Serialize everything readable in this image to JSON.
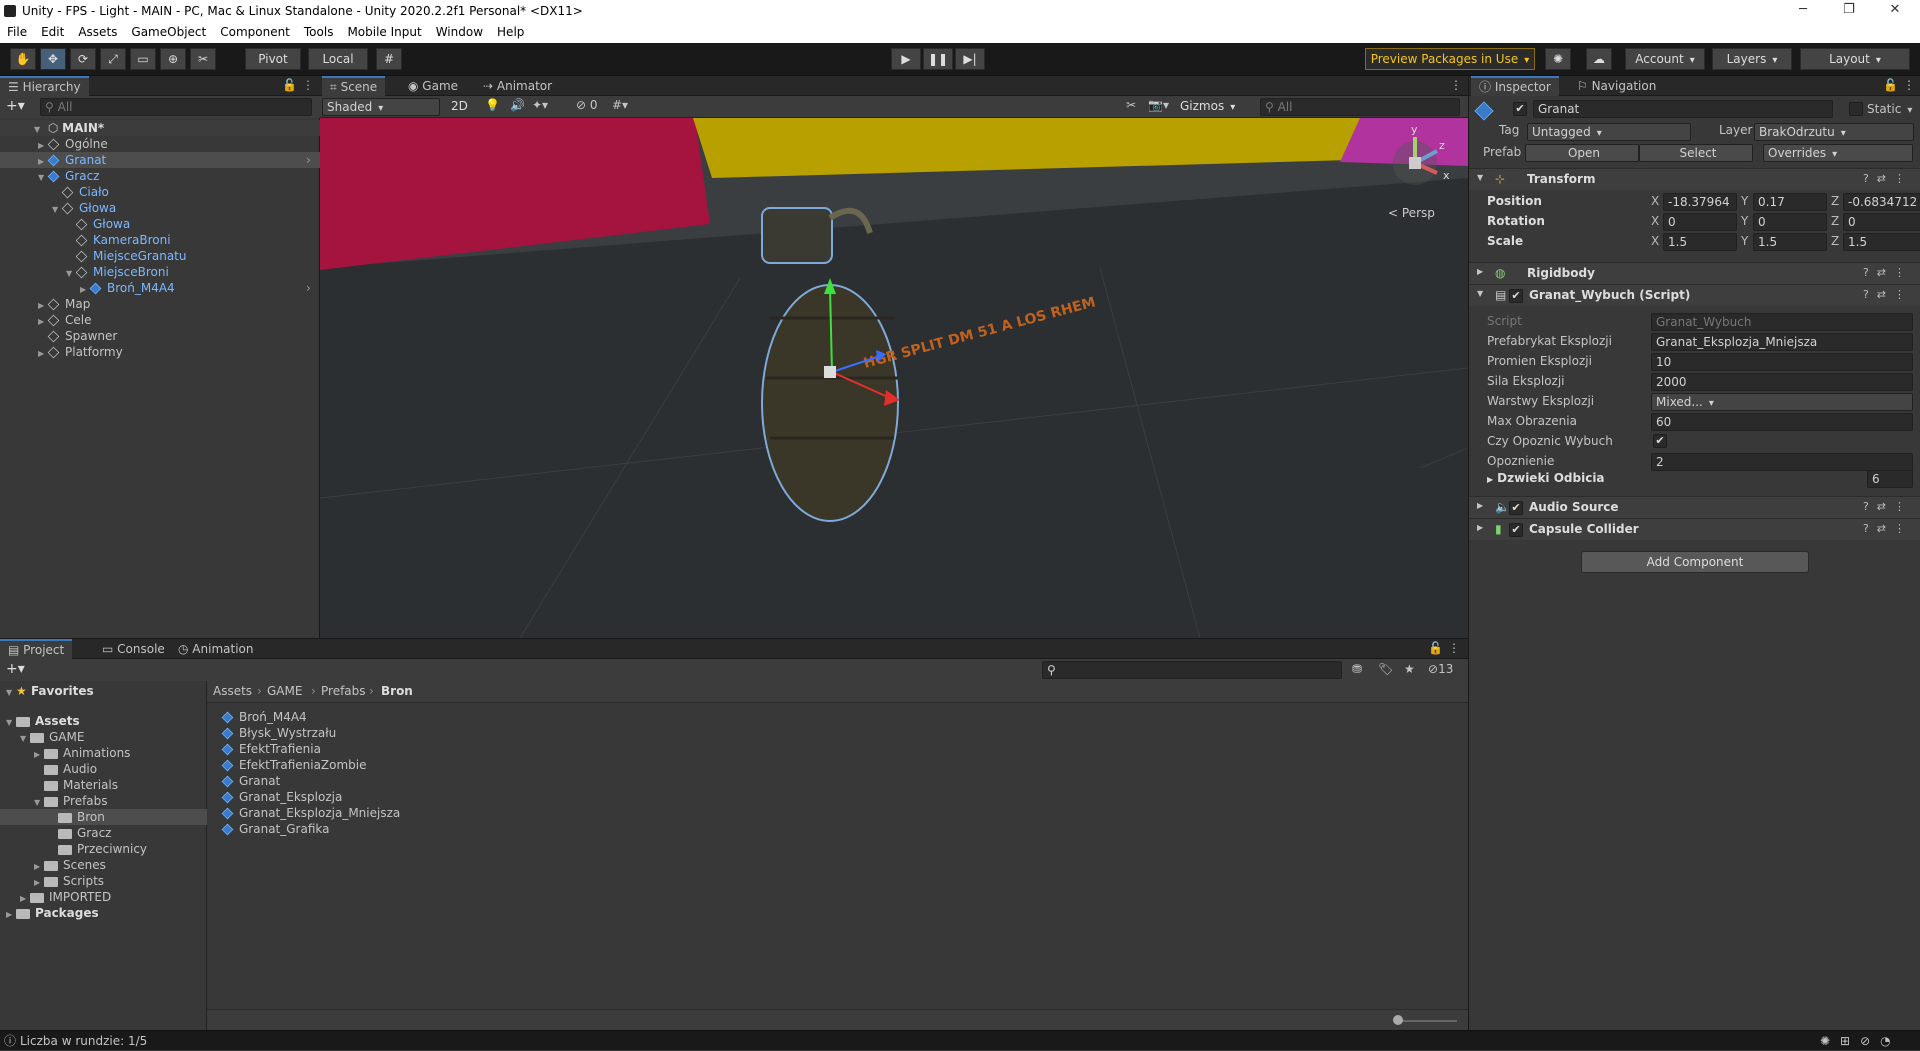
{
  "title": "Unity - FPS - Light - MAIN - PC, Mac & Linux Standalone - Unity 2020.2.2f1 Personal* <DX11>",
  "menu": [
    "File",
    "Edit",
    "Assets",
    "GameObject",
    "Component",
    "Tools",
    "Mobile Input",
    "Window",
    "Help"
  ],
  "toolbar": {
    "pivot": "Pivot",
    "local": "Local",
    "preview": "Preview Packages in Use",
    "account": "Account",
    "layers": "Layers",
    "layout": "Layout"
  },
  "hierarchy": {
    "tab": "Hierarchy",
    "search": "All",
    "scene": "MAIN*",
    "items": [
      {
        "label": "Ogólne",
        "depth": 1,
        "exp": "▶",
        "prefab": false
      },
      {
        "label": "Granat",
        "depth": 1,
        "exp": "▶",
        "prefab": true,
        "sel": true
      },
      {
        "label": "Gracz",
        "depth": 1,
        "exp": "▼",
        "prefab": true
      },
      {
        "label": "Ciało",
        "depth": 2,
        "exp": "",
        "prefab": false,
        "blue": true
      },
      {
        "label": "Głowa",
        "depth": 2,
        "exp": "▼",
        "prefab": false,
        "blue": true
      },
      {
        "label": "Głowa",
        "depth": 3,
        "exp": "",
        "prefab": false,
        "blue": true
      },
      {
        "label": "KameraBroni",
        "depth": 3,
        "exp": "",
        "prefab": false,
        "blue": true
      },
      {
        "label": "MiejsceGranatu",
        "depth": 3,
        "exp": "",
        "prefab": false,
        "blue": true
      },
      {
        "label": "MiejsceBroni",
        "depth": 3,
        "exp": "▼",
        "prefab": false,
        "blue": true
      },
      {
        "label": "Broń_M4A4",
        "depth": 4,
        "exp": "▶",
        "prefab": true,
        "blue": true
      },
      {
        "label": "Map",
        "depth": 1,
        "exp": "▶",
        "prefab": false
      },
      {
        "label": "Cele",
        "depth": 1,
        "exp": "▶",
        "prefab": false
      },
      {
        "label": "Spawner",
        "depth": 1,
        "exp": "",
        "prefab": false
      },
      {
        "label": "Platformy",
        "depth": 1,
        "exp": "▶",
        "prefab": false
      }
    ]
  },
  "scene": {
    "tabs": [
      "Scene",
      "Game",
      "Animator"
    ],
    "shading": "Shaded",
    "mode2d": "2D",
    "hidden": "0",
    "gizmos": "Gizmos",
    "search": "All",
    "persp": "Persp",
    "grenade_text": "HGR SPLIT DM 51 A LOS RHEM"
  },
  "inspector": {
    "tabs": [
      "Inspector",
      "Navigation"
    ],
    "object": "Granat",
    "static": "Static",
    "tag_label": "Tag",
    "tag": "Untagged",
    "layer_label": "Layer",
    "layer": "BrakOdrzutu",
    "prefab_label": "Prefab",
    "open": "Open",
    "select": "Select",
    "overrides": "Overrides",
    "transform": {
      "title": "Transform",
      "rows": [
        {
          "label": "Position",
          "x": "-18.37964",
          "y": "0.17",
          "z": "-0.6834712"
        },
        {
          "label": "Rotation",
          "x": "0",
          "y": "0",
          "z": "0"
        },
        {
          "label": "Scale",
          "x": "1.5",
          "y": "1.5",
          "z": "1.5"
        }
      ]
    },
    "rigidbody": "Rigidbody",
    "script": {
      "title": "Granat_Wybuch (Script)",
      "fields": [
        {
          "label": "Script",
          "value": "Granat_Wybuch"
        },
        {
          "label": "Prefabrykat Eksplozji",
          "value": "Granat_Eksplozja_Mniejsza"
        },
        {
          "label": "Promien Eksplozji",
          "value": "10"
        },
        {
          "label": "Sila Eksplozji",
          "value": "2000"
        },
        {
          "label": "Warstwy Eksplozji",
          "value": "Mixed..."
        },
        {
          "label": "Max Obrazenia",
          "value": "60"
        },
        {
          "label": "Czy Opoznic Wybuch",
          "value": "✔"
        },
        {
          "label": "Opoznienie",
          "value": "2"
        }
      ],
      "sounds_label": "Dzwieki Odbicia",
      "sounds_count": "6"
    },
    "audio": "Audio Source",
    "collider": "Capsule Collider",
    "add": "Add Component"
  },
  "project": {
    "tabs": [
      "Project",
      "Console",
      "Animation"
    ],
    "count": "13",
    "breadcrumb": [
      "Assets",
      "GAME",
      "Prefabs",
      "Bron"
    ],
    "tree": [
      {
        "label": "Favorites",
        "depth": 0,
        "exp": "▼",
        "bold": true,
        "star": true
      },
      {
        "label": "Assets",
        "depth": 0,
        "exp": "▼",
        "bold": true
      },
      {
        "label": "GAME",
        "depth": 1,
        "exp": "▼"
      },
      {
        "label": "Animations",
        "depth": 2,
        "exp": "▶"
      },
      {
        "label": "Audio",
        "depth": 2,
        "exp": ""
      },
      {
        "label": "Materials",
        "depth": 2,
        "exp": ""
      },
      {
        "label": "Prefabs",
        "depth": 2,
        "exp": "▼"
      },
      {
        "label": "Bron",
        "depth": 3,
        "exp": "",
        "sel": true
      },
      {
        "label": "Gracz",
        "depth": 3,
        "exp": ""
      },
      {
        "label": "Przeciwnicy",
        "depth": 3,
        "exp": ""
      },
      {
        "label": "Scenes",
        "depth": 2,
        "exp": "▶"
      },
      {
        "label": "Scripts",
        "depth": 2,
        "exp": "▶"
      },
      {
        "label": "IMPORTED",
        "depth": 1,
        "exp": "▶"
      },
      {
        "label": "Packages",
        "depth": 0,
        "exp": "▶",
        "bold": true
      }
    ],
    "files": [
      "Broń_M4A4",
      "Błysk_Wystrzału",
      "EfektTrafienia",
      "EfektTrafieniaZombie",
      "Granat",
      "Granat_Eksplozja",
      "Granat_Eksplozja_Mniejsza",
      "Granat_Grafika"
    ]
  },
  "status": "Liczba w rundzie: 1/5",
  "colors": {
    "accent": "#3a79bb",
    "selection": "#2c5d87",
    "preview": "#f5c518"
  }
}
